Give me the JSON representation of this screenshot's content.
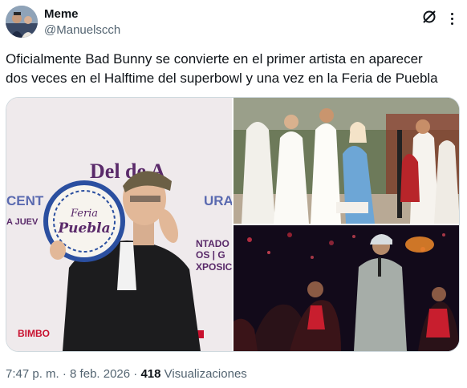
{
  "author": {
    "display_name": "Meme",
    "handle": "@Manuelscch"
  },
  "tweet": {
    "text_line1": "Oficialmente Bad Bunny se convierte en el primer artista en aparecer",
    "text_line2": "dos veces en el Halftime del superbowl y una vez en la Feria de Puebla"
  },
  "media": {
    "left_photo_text": {
      "banner_title": "Del    de A",
      "banner_line2": "CENT",
      "banner_line3": "URA",
      "banner_line4": "A JUEV",
      "banner_line5": "NTADO",
      "banner_line6": "OS | G",
      "banner_line7": "XPOSIC",
      "sponsor": "BIMBO",
      "plate_line1": "Feria",
      "plate_line2": "Puebla"
    }
  },
  "footer": {
    "time": "7:47 p. m.",
    "separator": " · ",
    "date": "8 feb. 2026",
    "views_count": "418",
    "views_label": "Visualizaciones"
  },
  "colors": {
    "text": "#0f1419",
    "secondary": "#536471",
    "border": "#cfd9de",
    "banner_purple": "#5a2a6a",
    "banner_red": "#c8102e"
  }
}
